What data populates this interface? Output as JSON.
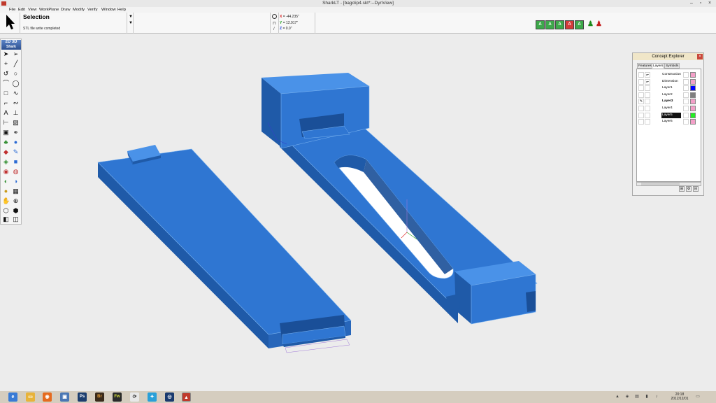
{
  "window": {
    "title": "SharkLT - [bagclip4.skt*:--DynView]"
  },
  "menu": [
    "File",
    "Edit",
    "View",
    "WorkPlane",
    "Draw",
    "Modify",
    "Verify",
    "Window",
    "Help"
  ],
  "ribbon": {
    "mode_title": "Selection",
    "status": "STL file write completed",
    "coords": {
      "x_label": "X",
      "x_value": "= -44.235\"",
      "y_label": "Y",
      "y_value": "= 12.917\"",
      "z_label": "Z",
      "z_value": "= 0.0\""
    }
  },
  "toolbox": {
    "logo_2d": "2D",
    "logo_3d": "3D",
    "logo_text": "Shark"
  },
  "view_tools": [
    "layer-icon",
    "layers-icon",
    "layer-delete-icon",
    "layer-visibility-icon",
    "layer-color-icon",
    "user-green-icon",
    "user-red-icon"
  ],
  "concept_explorer": {
    "title": "Concept Explorer",
    "tabs": [
      "Features",
      "Layers",
      "Symbols"
    ],
    "active_tab": "Layers",
    "layers": [
      {
        "name": "Construction",
        "color": "#f3a0c8",
        "selected": false,
        "current": false
      },
      {
        "name": "Dimension",
        "color": "#f3a0c8",
        "selected": false,
        "current": false
      },
      {
        "name": "Layer1",
        "color": "#0000ff",
        "selected": false,
        "current": false
      },
      {
        "name": "Layer2",
        "color": "#7f7f7f",
        "selected": false,
        "current": false
      },
      {
        "name": "Layer3",
        "color": "#f3a0c8",
        "selected": false,
        "current": true
      },
      {
        "name": "Layer4",
        "color": "#f3a0c8",
        "selected": false,
        "current": false
      },
      {
        "name": "Layer5",
        "color": "#22ee22",
        "selected": true,
        "current": false
      },
      {
        "name": "Layer6",
        "color": "#f3a0c8",
        "selected": false,
        "current": false
      }
    ]
  },
  "taskbar": {
    "time": "20:18",
    "date": "2012/12/01"
  },
  "colors": {
    "model_blue": "#2f76d2",
    "model_dark": "#1f5aa8",
    "model_light": "#4a92e8"
  }
}
